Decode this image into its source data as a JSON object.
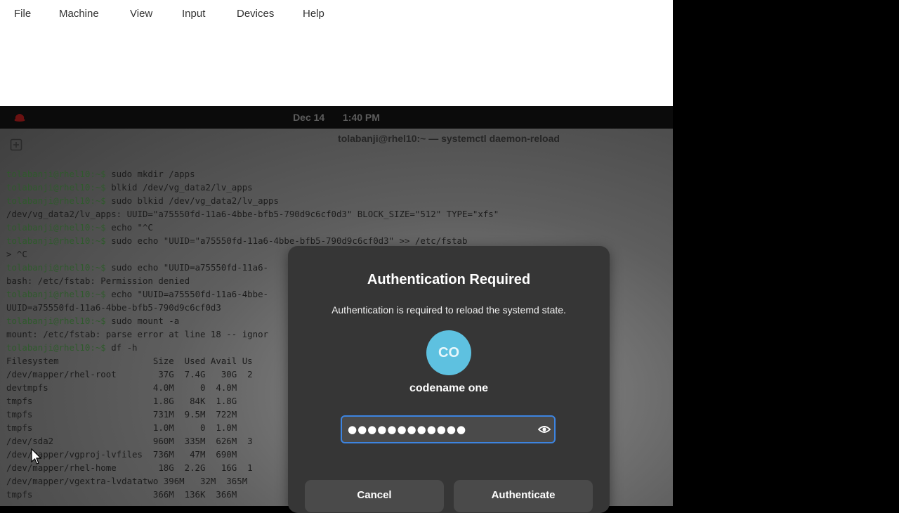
{
  "menubar": {
    "items": [
      "File",
      "Machine",
      "View",
      "Input",
      "Devices",
      "Help"
    ]
  },
  "guest": {
    "clock": {
      "date": "Dec 14",
      "time": "1:40 PM"
    },
    "terminal": {
      "title": "tolabanji@rhel10:~ — systemctl daemon-reload",
      "prompt": "tolabanji@rhel10:~$",
      "lines": [
        {
          "prompt": true,
          "text": " sudo mkdir /apps"
        },
        {
          "prompt": true,
          "text": " blkid /dev/vg_data2/lv_apps"
        },
        {
          "prompt": true,
          "text": " sudo blkid /dev/vg_data2/lv_apps"
        },
        {
          "prompt": false,
          "text": "/dev/vg_data2/lv_apps: UUID=\"a75550fd-11a6-4bbe-bfb5-790d9c6cf0d3\" BLOCK_SIZE=\"512\" TYPE=\"xfs\""
        },
        {
          "prompt": true,
          "text": " echo \"^C"
        },
        {
          "prompt": true,
          "text": " sudo echo \"UUID=\"a75550fd-11a6-4bbe-bfb5-790d9c6cf0d3\" >> /etc/fstab"
        },
        {
          "prompt": false,
          "text": "> ^C"
        },
        {
          "prompt": true,
          "text": " sudo echo \"UUID=a75550fd-11a6-"
        },
        {
          "prompt": false,
          "text": "bash: /etc/fstab: Permission denied"
        },
        {
          "prompt": true,
          "text": " echo \"UUID=a75550fd-11a6-4bbe-"
        },
        {
          "prompt": false,
          "text": "UUID=a75550fd-11a6-4bbe-bfb5-790d9c6cf0d3"
        },
        {
          "prompt": true,
          "text": " sudo mount -a"
        },
        {
          "prompt": false,
          "text": "mount: /etc/fstab: parse error at line 18 -- ignor"
        },
        {
          "prompt": true,
          "text": " df -h"
        },
        {
          "prompt": false,
          "text": "Filesystem                  Size  Used Avail Us"
        },
        {
          "prompt": false,
          "text": "/dev/mapper/rhel-root        37G  7.4G   30G  2"
        },
        {
          "prompt": false,
          "text": "devtmpfs                    4.0M     0  4.0M"
        },
        {
          "prompt": false,
          "text": "tmpfs                       1.8G   84K  1.8G"
        },
        {
          "prompt": false,
          "text": "tmpfs                       731M  9.5M  722M"
        },
        {
          "prompt": false,
          "text": "tmpfs                       1.0M     0  1.0M"
        },
        {
          "prompt": false,
          "text": "/dev/sda2                   960M  335M  626M  3"
        },
        {
          "prompt": false,
          "text": "/dev/mapper/vgproj-lvfiles  736M   47M  690M"
        },
        {
          "prompt": false,
          "text": "/dev/mapper/rhel-home        18G  2.2G   16G  1"
        },
        {
          "prompt": false,
          "text": "/dev/mapper/vgextra-lvdatatwo 396M   32M  365M"
        },
        {
          "prompt": false,
          "text": "tmpfs                       366M  136K  366M"
        }
      ]
    }
  },
  "dialog": {
    "title": "Authentication Required",
    "message": "Authentication is required to reload the systemd state.",
    "avatar_initials": "CO",
    "username": "codename one",
    "password_value": "●●●●●●●●●●●●",
    "cancel_label": "Cancel",
    "authenticate_label": "Authenticate",
    "avatar_color": "#5ec1e0",
    "focus_color": "#3d84e0"
  }
}
